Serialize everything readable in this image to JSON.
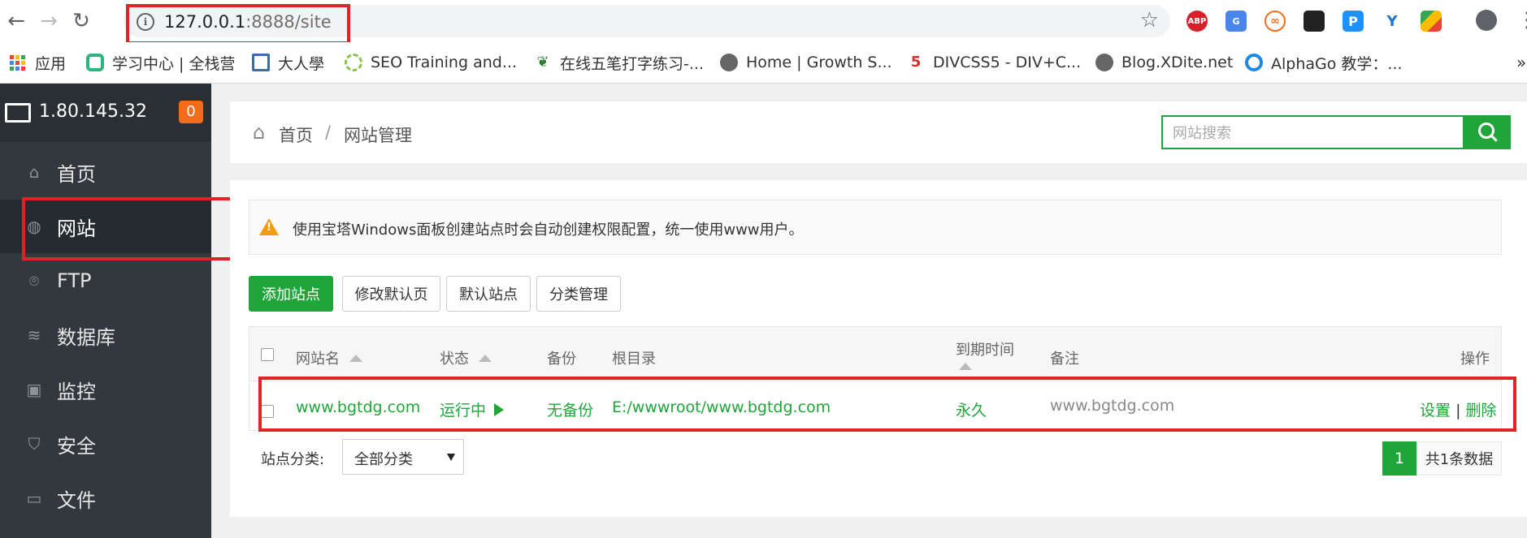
{
  "browser": {
    "url_host": "127.0.0.1",
    "url_rest": ":8888/site",
    "bookmarks": [
      {
        "label": "应用",
        "icon": "apps-grid-icon"
      },
      {
        "label": "学习中心 | 全栈营",
        "icon": "fullstack-icon"
      },
      {
        "label": "大人學",
        "icon": "bookmark-icon"
      },
      {
        "label": "SEO Training and...",
        "icon": "ring-icon"
      },
      {
        "label": "在线五笔打字练习-...",
        "icon": "wubi-icon"
      },
      {
        "label": "Home | Growth S...",
        "icon": "globe-icon"
      },
      {
        "label": "DIVCSS5 - DIV+C...",
        "icon": "divcss5-icon"
      },
      {
        "label": "Blog.XDite.net",
        "icon": "globe-icon"
      },
      {
        "label": "AlphaGo 教学：...",
        "icon": "alphago-icon"
      }
    ],
    "extensions": [
      "ABP",
      "G",
      "∞",
      "",
      "P",
      "Y",
      ""
    ]
  },
  "sidebar": {
    "host_ip": "1.80.145.32",
    "badge": "0",
    "items": [
      {
        "label": "首页",
        "icon": "home-icon"
      },
      {
        "label": "网站",
        "icon": "globe-icon"
      },
      {
        "label": "FTP",
        "icon": "ftp-icon"
      },
      {
        "label": "数据库",
        "icon": "database-icon"
      },
      {
        "label": "监控",
        "icon": "monitor-chart-icon"
      },
      {
        "label": "安全",
        "icon": "shield-icon"
      },
      {
        "label": "文件",
        "icon": "folder-icon"
      }
    ]
  },
  "breadcrumb": {
    "home": "首页",
    "separator": "/",
    "current": "网站管理"
  },
  "search": {
    "placeholder": "网站搜索"
  },
  "notice": "使用宝塔Windows面板创建站点时会自动创建权限配置，统一使用www用户。",
  "toolbar": {
    "add_site": "添加站点",
    "modify_default_page": "修改默认页",
    "default_site": "默认站点",
    "category_manage": "分类管理"
  },
  "table": {
    "headers": {
      "name": "网站名",
      "status": "状态",
      "backup": "备份",
      "root": "根目录",
      "expiry": "到期时间",
      "remark": "备注",
      "actions": "操作"
    },
    "rows": [
      {
        "name": "www.bgtdg.com",
        "status": "运行中",
        "backup": "无备份",
        "root": "E:/wwwroot/www.bgtdg.com",
        "expiry": "永久",
        "remark": "www.bgtdg.com",
        "action_settings": "设置",
        "action_sep": "|",
        "action_delete": "删除"
      }
    ]
  },
  "footer": {
    "category_label": "站点分类:",
    "category_value": "全部分类",
    "page": "1",
    "total": "共1条数据"
  },
  "colors": {
    "accent": "#20a53a",
    "sidebar_bg": "#32383d",
    "highlight": "#e12326",
    "badge": "#f26c1c",
    "warning": "#f39c12"
  }
}
